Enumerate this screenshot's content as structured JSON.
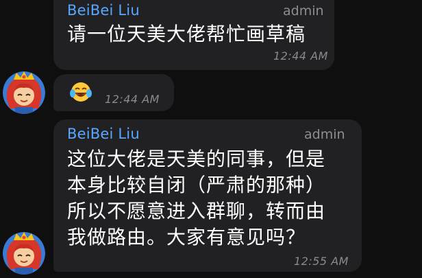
{
  "messages": [
    {
      "sender": "BeiBei Liu",
      "role": "admin",
      "text": "请一位天美大佬帮忙画草稿",
      "time": "12:44 AM"
    },
    {
      "emoji": "tears-of-joy-emoji",
      "time": "12:44 AM"
    },
    {
      "sender": "BeiBei Liu",
      "role": "admin",
      "lines": [
        "这位大佬是天美的同事，但是",
        "本身比较自闭（严肃的那种）",
        "所以不愿意进入群聊，转而由",
        "我做路由。大家有意见吗？"
      ],
      "time": "12:55 AM"
    }
  ],
  "colors": {
    "background": "#0f0f10",
    "bubble": "#212124",
    "sender_name": "#58a8ff",
    "meta_text": "#8a8a8f",
    "message_text": "#ffffff"
  },
  "icons": [
    "tears-of-joy-emoji",
    "user-avatar"
  ]
}
